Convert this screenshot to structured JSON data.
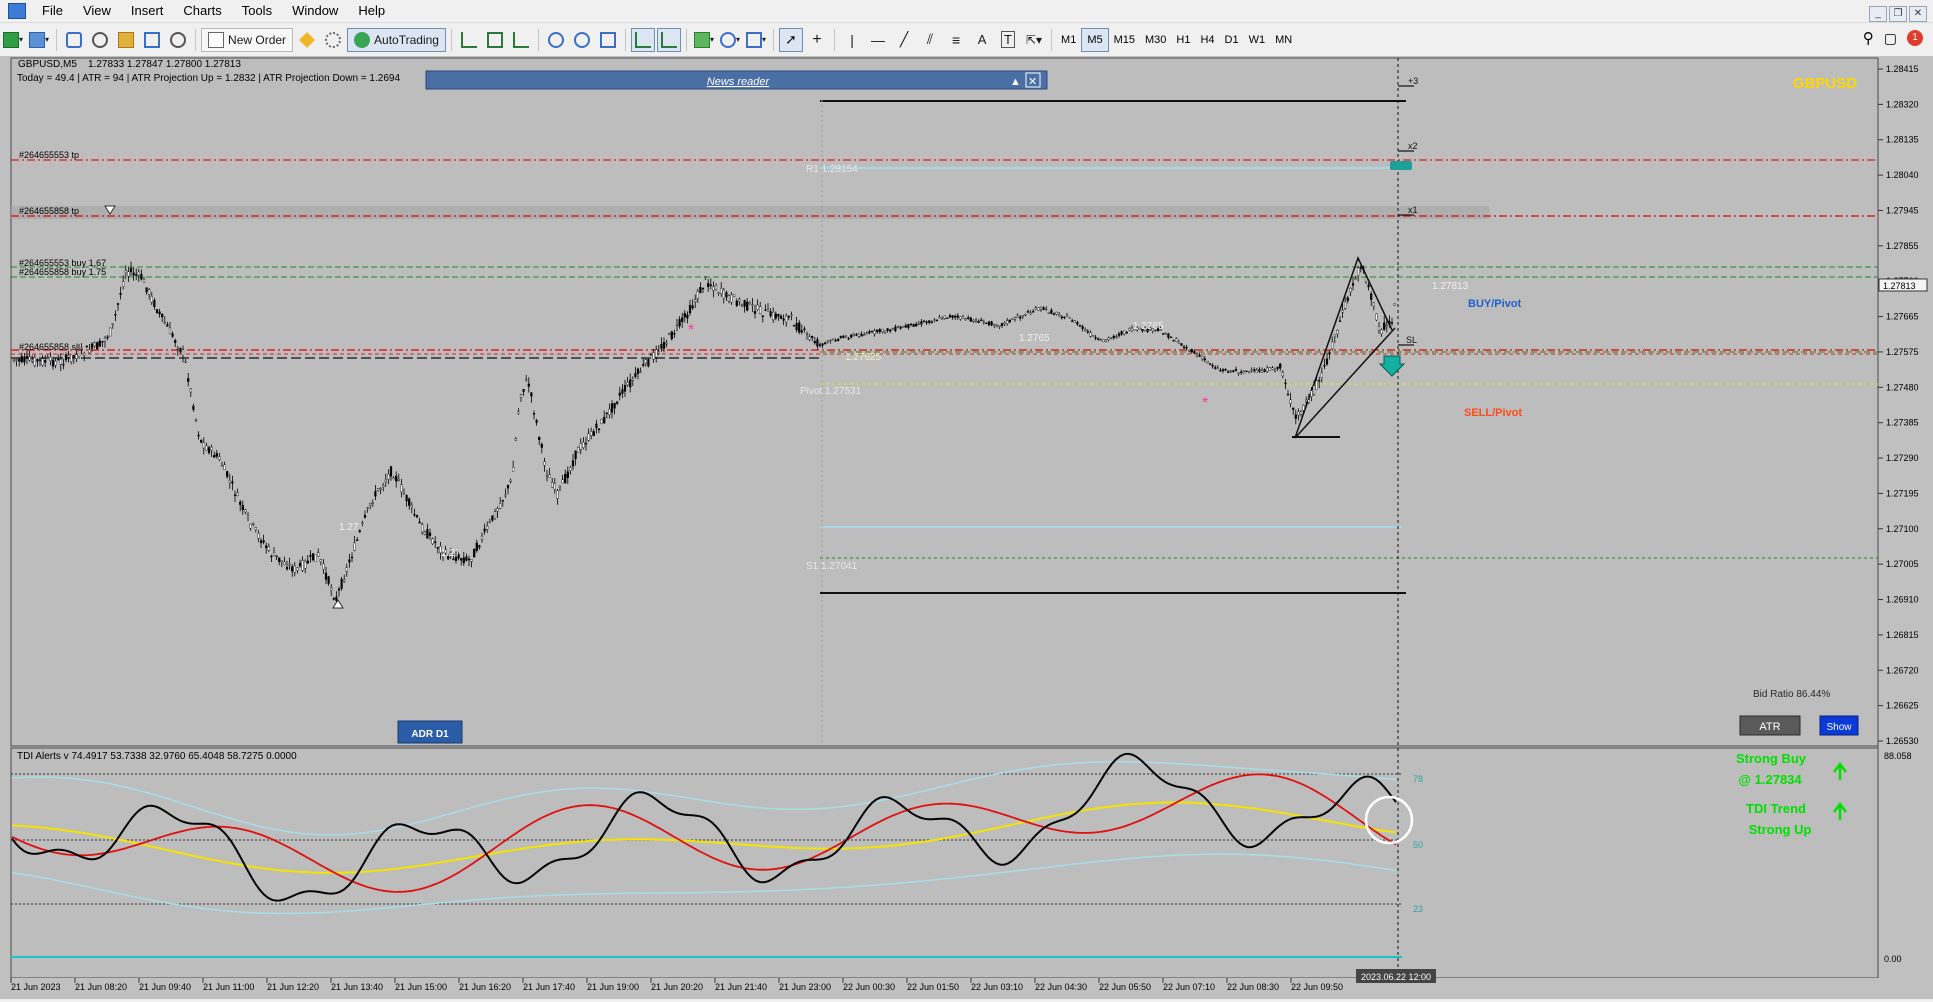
{
  "menubar": {
    "items": [
      "File",
      "View",
      "Insert",
      "Charts",
      "Tools",
      "Window",
      "Help"
    ]
  },
  "toolbar": {
    "new_order_label": "New Order",
    "autotrading_label": "AutoTrading",
    "timeframes": [
      "M1",
      "M5",
      "M15",
      "M30",
      "H1",
      "H4",
      "D1",
      "W1",
      "MN"
    ],
    "active_timeframe": "M5"
  },
  "chart": {
    "header_symbol": "GBPUSD,M5",
    "header_ohlc": "1.27833 1.27847 1.27800 1.27813",
    "info_line": "Today = 49.4    |    ATR = 94    |    ATR Projection Up = 1.2832    |    ATR Projection Down = 1.2694",
    "watermark_symbol": "GBPUSD",
    "news_reader_label": "News reader",
    "adr_label": "ADR D1",
    "atr_button_label": "ATR",
    "show_button_label": "Show",
    "bid_ratio": "Bid Ratio 86.44%",
    "buy_pivot_label": "BUY/Pivot",
    "sell_pivot_label": "SELL/Pivot",
    "current_price": "1.27813",
    "price_axis": [
      "1.28415",
      "1.28320",
      "1.28135",
      "1.28040",
      "1.27945",
      "1.27855",
      "1.27760",
      "1.27665",
      "1.27575",
      "1.27480",
      "1.27385",
      "1.27290",
      "1.27195",
      "1.27100",
      "1.27005",
      "1.26910",
      "1.26815",
      "1.26720",
      "1.26625",
      "1.26530"
    ],
    "order_labels": {
      "tp1": "#264655553 tp",
      "tp2": "#264655858 tp",
      "buy1": "#264655553 buy 1.67",
      "buy2": "#264655858 buy 1.75",
      "sl": "#264655858 sl"
    },
    "level_labels": {
      "r1": "R1  1.28154",
      "pivot": "Pivot  1.27531",
      "s1": "S1  1.27041",
      "lab_1": "1.27",
      "lab_2": "1.27",
      "lab_3": "1.2765",
      "lab_4": "1.2765",
      "lab_5": "1.27813",
      "lab_6": "1.27625"
    },
    "proj_labels": [
      "+3",
      "x2",
      "x1",
      "SL"
    ],
    "time_axis": [
      "21 Jun 2023",
      "21 Jun 08:20",
      "21 Jun 09:40",
      "21 Jun 11:00",
      "21 Jun 12:20",
      "21 Jun 13:40",
      "21 Jun 15:00",
      "21 Jun 16:20",
      "21 Jun 17:40",
      "21 Jun 19:00",
      "21 Jun 20:20",
      "21 Jun 21:40",
      "21 Jun 23:00",
      "22 Jun 00:30",
      "22 Jun 01:50",
      "22 Jun 03:10",
      "22 Jun 04:30",
      "22 Jun 05:50",
      "22 Jun 07:10",
      "22 Jun 08:30",
      "22 Jun 09:50"
    ],
    "time_cursor": "2023.06.22 12:00"
  },
  "indicator": {
    "title": "TDI Alerts v 74.4917 53.7338 32.9760 65.4048 58.7275 0.0000",
    "levels": [
      "78",
      "50",
      "23"
    ],
    "axis_top": "88.058",
    "axis_bottom": "0.00",
    "strong_buy_line1": "Strong Buy",
    "strong_buy_line2": "@ 1.27834",
    "tdi_trend_line1": "TDI Trend",
    "tdi_trend_line2": "Strong Up"
  },
  "colors": {
    "chart_bg": "#c0c0c0",
    "buy_label": "#1f5fd0",
    "sell_label": "#ff4a1a",
    "watermark": "#ffd700",
    "tdi_green": "#00e000"
  }
}
